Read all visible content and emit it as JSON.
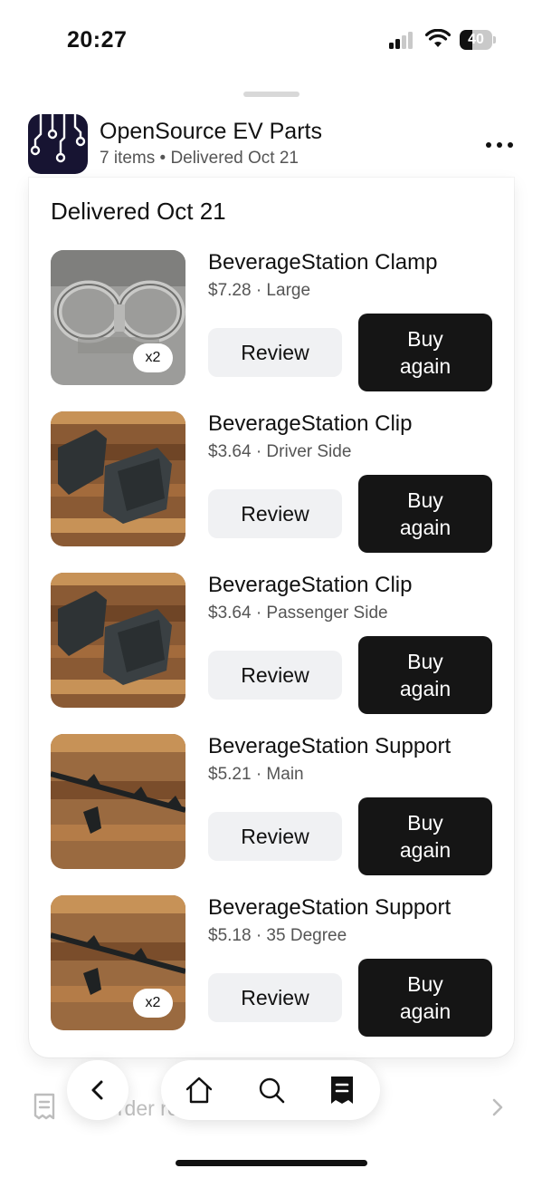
{
  "status_bar": {
    "time": "20:27",
    "battery": "40",
    "battery_level": 0.4
  },
  "header": {
    "shop_name": "OpenSource EV Parts",
    "subtitle": "7 items • Delivered Oct 21",
    "more_icon": "more-horizontal-icon"
  },
  "order": {
    "title": "Delivered Oct 21",
    "items": [
      {
        "name": "BeverageStation Clamp",
        "meta": "$7.28 · Large",
        "qty": "x2",
        "review_label": "Review",
        "buy_label": "Buy again"
      },
      {
        "name": "BeverageStation Clip",
        "meta": "$3.64 · Driver Side",
        "qty": "",
        "review_label": "Review",
        "buy_label": "Buy again"
      },
      {
        "name": "BeverageStation Clip",
        "meta": "$3.64 · Passenger Side",
        "qty": "",
        "review_label": "Review",
        "buy_label": "Buy again"
      },
      {
        "name": "BeverageStation Support",
        "meta": "$5.21 · Main",
        "qty": "",
        "review_label": "Review",
        "buy_label": "Buy again"
      },
      {
        "name": "BeverageStation Support",
        "meta": "$5.18 · 35 Degree",
        "qty": "x2",
        "review_label": "Review",
        "buy_label": "Buy again"
      }
    ]
  },
  "bottom": {
    "receipt_label": "Order receipt",
    "tabs": [
      "home-icon",
      "search-icon",
      "receipt-icon"
    ],
    "active_tab": "receipt-icon"
  },
  "colors": {
    "primary_button": "#151515",
    "secondary_button": "#f0f1f3",
    "logo_bg": "#171432",
    "wood": "#8a5a34"
  }
}
